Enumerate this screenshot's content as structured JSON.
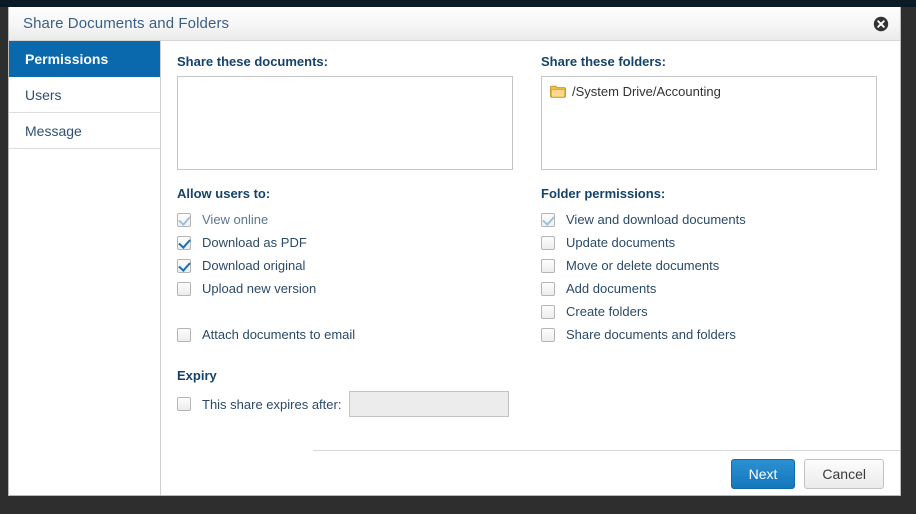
{
  "window": {
    "title": "Share Documents and Folders",
    "close_icon": "close-circle-icon"
  },
  "sidebar": {
    "items": [
      {
        "label": "Permissions",
        "active": true
      },
      {
        "label": "Users",
        "active": false
      },
      {
        "label": "Message",
        "active": false
      }
    ]
  },
  "left_column": {
    "documents_label": "Share these documents:",
    "documents_items": [],
    "allow_users_label": "Allow users to:",
    "allow_users_options": [
      {
        "label": "View online",
        "checked": true,
        "disabled": true
      },
      {
        "label": "Download as PDF",
        "checked": true,
        "disabled": false
      },
      {
        "label": "Download original",
        "checked": true,
        "disabled": false
      },
      {
        "label": "Upload new version",
        "checked": false,
        "disabled": false
      }
    ],
    "attach_option": {
      "label": "Attach documents to email",
      "checked": false
    },
    "expiry_label": "Expiry",
    "expiry_option": {
      "label": "This share expires after:",
      "checked": false
    },
    "expiry_input_value": "",
    "expiry_input_placeholder": ""
  },
  "right_column": {
    "folders_label": "Share these folders:",
    "folders_items": [
      {
        "path": "/System Drive/Accounting",
        "icon": "folder-icon"
      }
    ],
    "folder_permissions_label": "Folder permissions:",
    "folder_permissions_options": [
      {
        "label": "View and download documents",
        "checked": true,
        "disabled": false
      },
      {
        "label": "Update documents",
        "checked": false,
        "disabled": false
      },
      {
        "label": "Move or delete documents",
        "checked": false,
        "disabled": false
      },
      {
        "label": "Add documents",
        "checked": false,
        "disabled": false
      },
      {
        "label": "Create folders",
        "checked": false,
        "disabled": false
      },
      {
        "label": "Share documents and folders",
        "checked": false,
        "disabled": false
      }
    ]
  },
  "footer": {
    "next_label": "Next",
    "cancel_label": "Cancel"
  },
  "colors": {
    "accent_blue": "#0a69ac",
    "primary_button": "#1477bd",
    "heading_text": "#16436b",
    "title_text": "#3a5f86",
    "overlay": "#2e2e2e",
    "top_band": "#0b1b26"
  }
}
